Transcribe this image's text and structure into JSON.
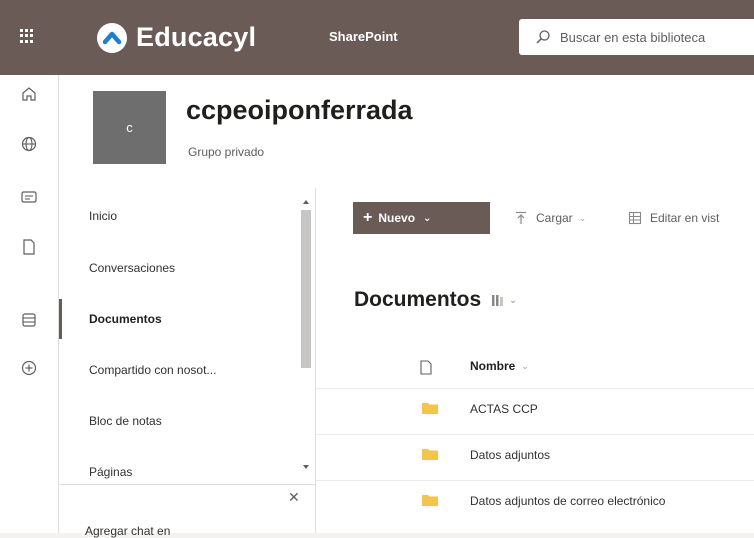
{
  "topbar": {
    "brand": "Educacyl",
    "product": "SharePoint",
    "search_placeholder": "Buscar en esta biblioteca"
  },
  "rail": {
    "icons": [
      "home-icon",
      "globe-icon",
      "news-icon",
      "file-icon",
      "lists-icon",
      "create-icon"
    ]
  },
  "site": {
    "logo_letter": "c",
    "title": "ccpeoiponferrada",
    "subtitle": "Grupo privado"
  },
  "leftnav": {
    "items": [
      {
        "label": "Inicio"
      },
      {
        "label": "Conversaciones"
      },
      {
        "label": "Documentos"
      },
      {
        "label": "Compartido con nosot..."
      },
      {
        "label": "Bloc de notas"
      },
      {
        "label": "Páginas"
      }
    ],
    "active_index": 2,
    "chat_prompt": "Agregar chat en"
  },
  "commandbar": {
    "new_label": "Nuevo",
    "upload_label": "Cargar",
    "edit_label": "Editar en vist"
  },
  "library": {
    "title": "Documentos",
    "column_name": "Nombre",
    "rows": [
      {
        "name": "ACTAS CCP"
      },
      {
        "name": "Datos adjuntos"
      },
      {
        "name": "Datos adjuntos de correo electrónico"
      }
    ]
  },
  "colors": {
    "brand": "#6b5b57",
    "folder": "#f3c64b"
  }
}
